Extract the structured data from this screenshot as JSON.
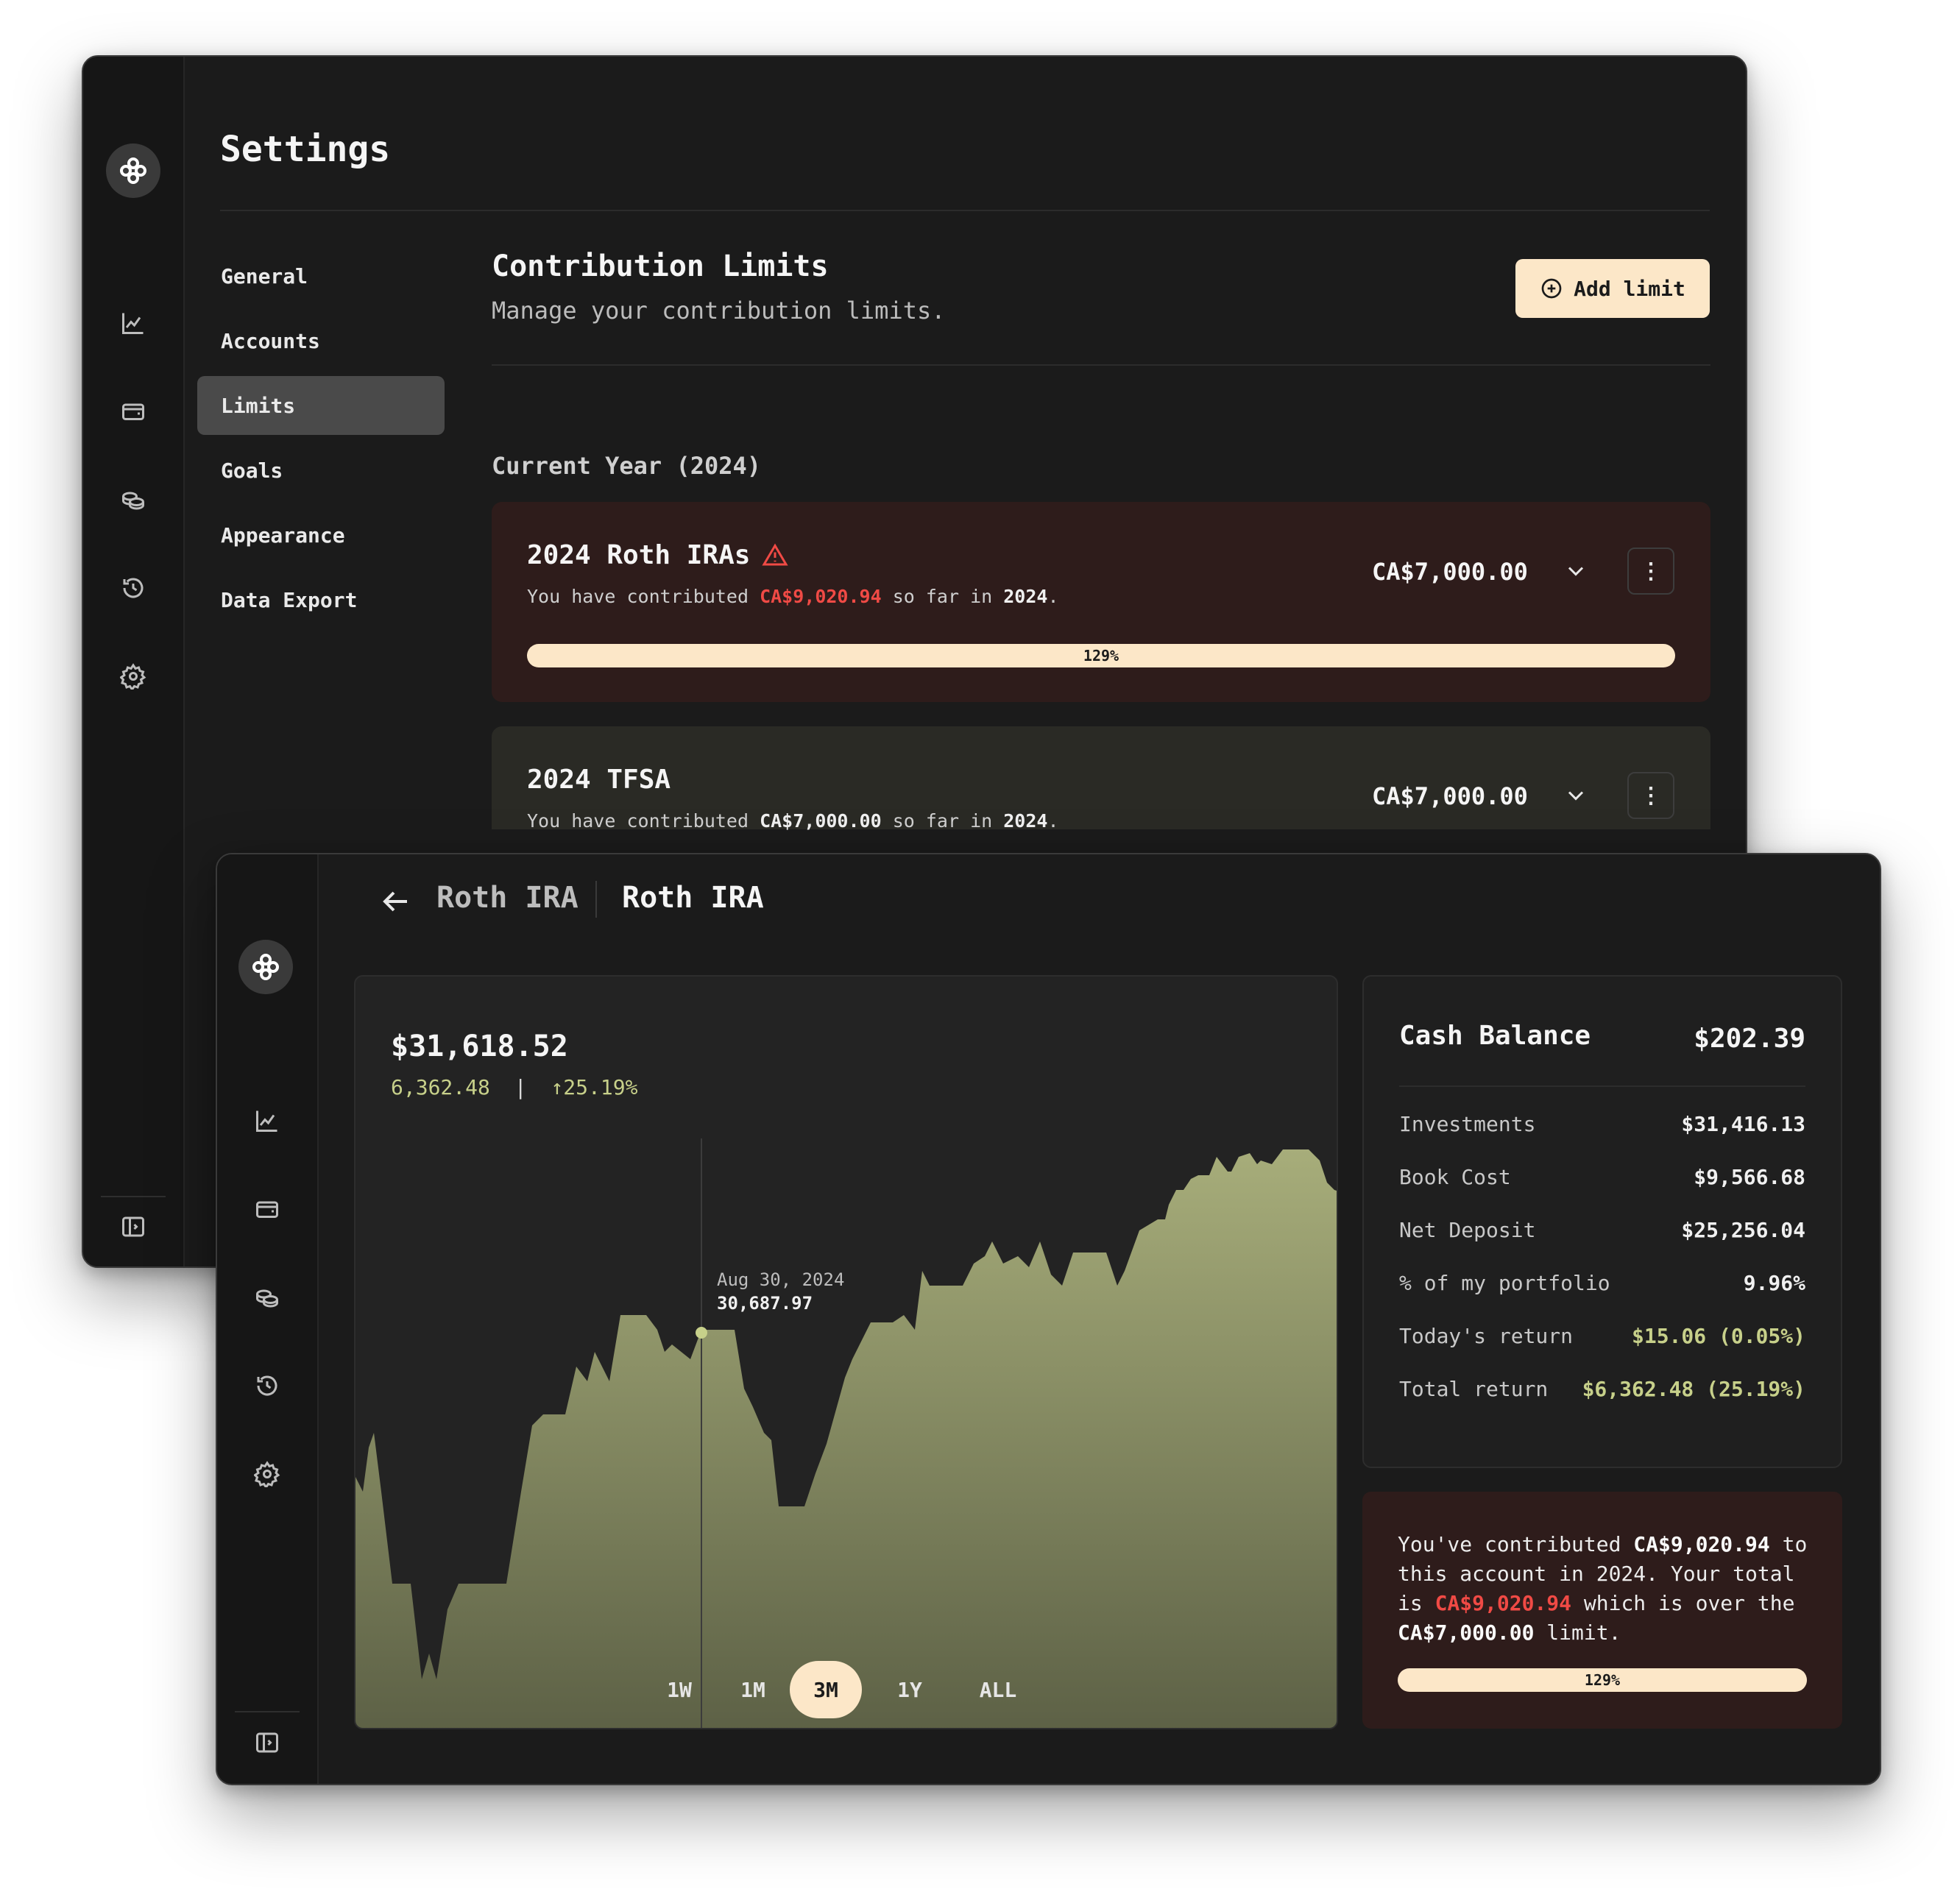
{
  "settings_window": {
    "title": "Settings",
    "nav": [
      "General",
      "Accounts",
      "Limits",
      "Goals",
      "Appearance",
      "Data Export"
    ],
    "active_nav": "Limits",
    "section": {
      "title": "Contribution Limits",
      "subtitle": "Manage your contribution limits.",
      "add_button": "Add limit"
    },
    "year_label": "Current Year (2024)",
    "limits": [
      {
        "title": "2024 Roth IRAs",
        "desc_prefix": "You have contributed ",
        "contributed": "CA$9,020.94",
        "desc_mid": " so far in ",
        "year": "2024",
        "desc_suffix": ".",
        "amount": "CA$7,000.00",
        "progress_label": "129%",
        "progress": 1.29,
        "over_limit": true
      },
      {
        "title": "2024 TFSA",
        "desc_prefix": "You have contributed ",
        "contributed": "CA$7,000.00",
        "desc_mid": " so far in ",
        "year": "2024",
        "desc_suffix": ".",
        "amount": "CA$7,000.00",
        "over_limit": false
      }
    ]
  },
  "account_window": {
    "breadcrumb": [
      "Roth IRA",
      "Roth IRA"
    ],
    "chart": {
      "value": "$31,618.52",
      "change_abs": "6,362.48",
      "change_sep": "|",
      "change_pct": "↑25.19%",
      "tooltip_date": "Aug 30, 2024",
      "tooltip_value": "30,687.97",
      "ranges": [
        "1W",
        "1M",
        "3M",
        "1Y",
        "ALL"
      ],
      "active_range": "3M"
    },
    "cash_balance": {
      "label": "Cash Balance",
      "value": "$202.39"
    },
    "stats": [
      {
        "label": "Investments",
        "value": "$31,416.13"
      },
      {
        "label": "Book Cost",
        "value": "$9,566.68"
      },
      {
        "label": "Net Deposit",
        "value": "$25,256.04"
      },
      {
        "label": "% of my portfolio",
        "value": "9.96%"
      },
      {
        "label": "Today's return",
        "value": "$15.06 (0.05%)"
      },
      {
        "label": "Total return",
        "value": "$6,362.48 (25.19%)"
      }
    ],
    "warning": {
      "t1": "You've contributed ",
      "b1": "CA$9,020.94",
      "t2": " to this account in 2024. Your total is ",
      "r1": "CA$9,020.94",
      "t3": " which is over the ",
      "b2": "CA$7,000.00",
      "t4": " limit.",
      "progress_label": "129%",
      "progress": 1.29
    }
  },
  "colors": {
    "accent_cream": "#fce7c8",
    "danger": "#f04a45",
    "positive": "#c7d08a",
    "chart_fill_top": "#a7ad7a",
    "chart_fill_bottom": "#5d6146"
  },
  "chart_data": {
    "type": "area",
    "x": [
      "Aug 30, 2024"
    ],
    "series": [
      {
        "values": [
          30687.97
        ]
      }
    ]
  }
}
